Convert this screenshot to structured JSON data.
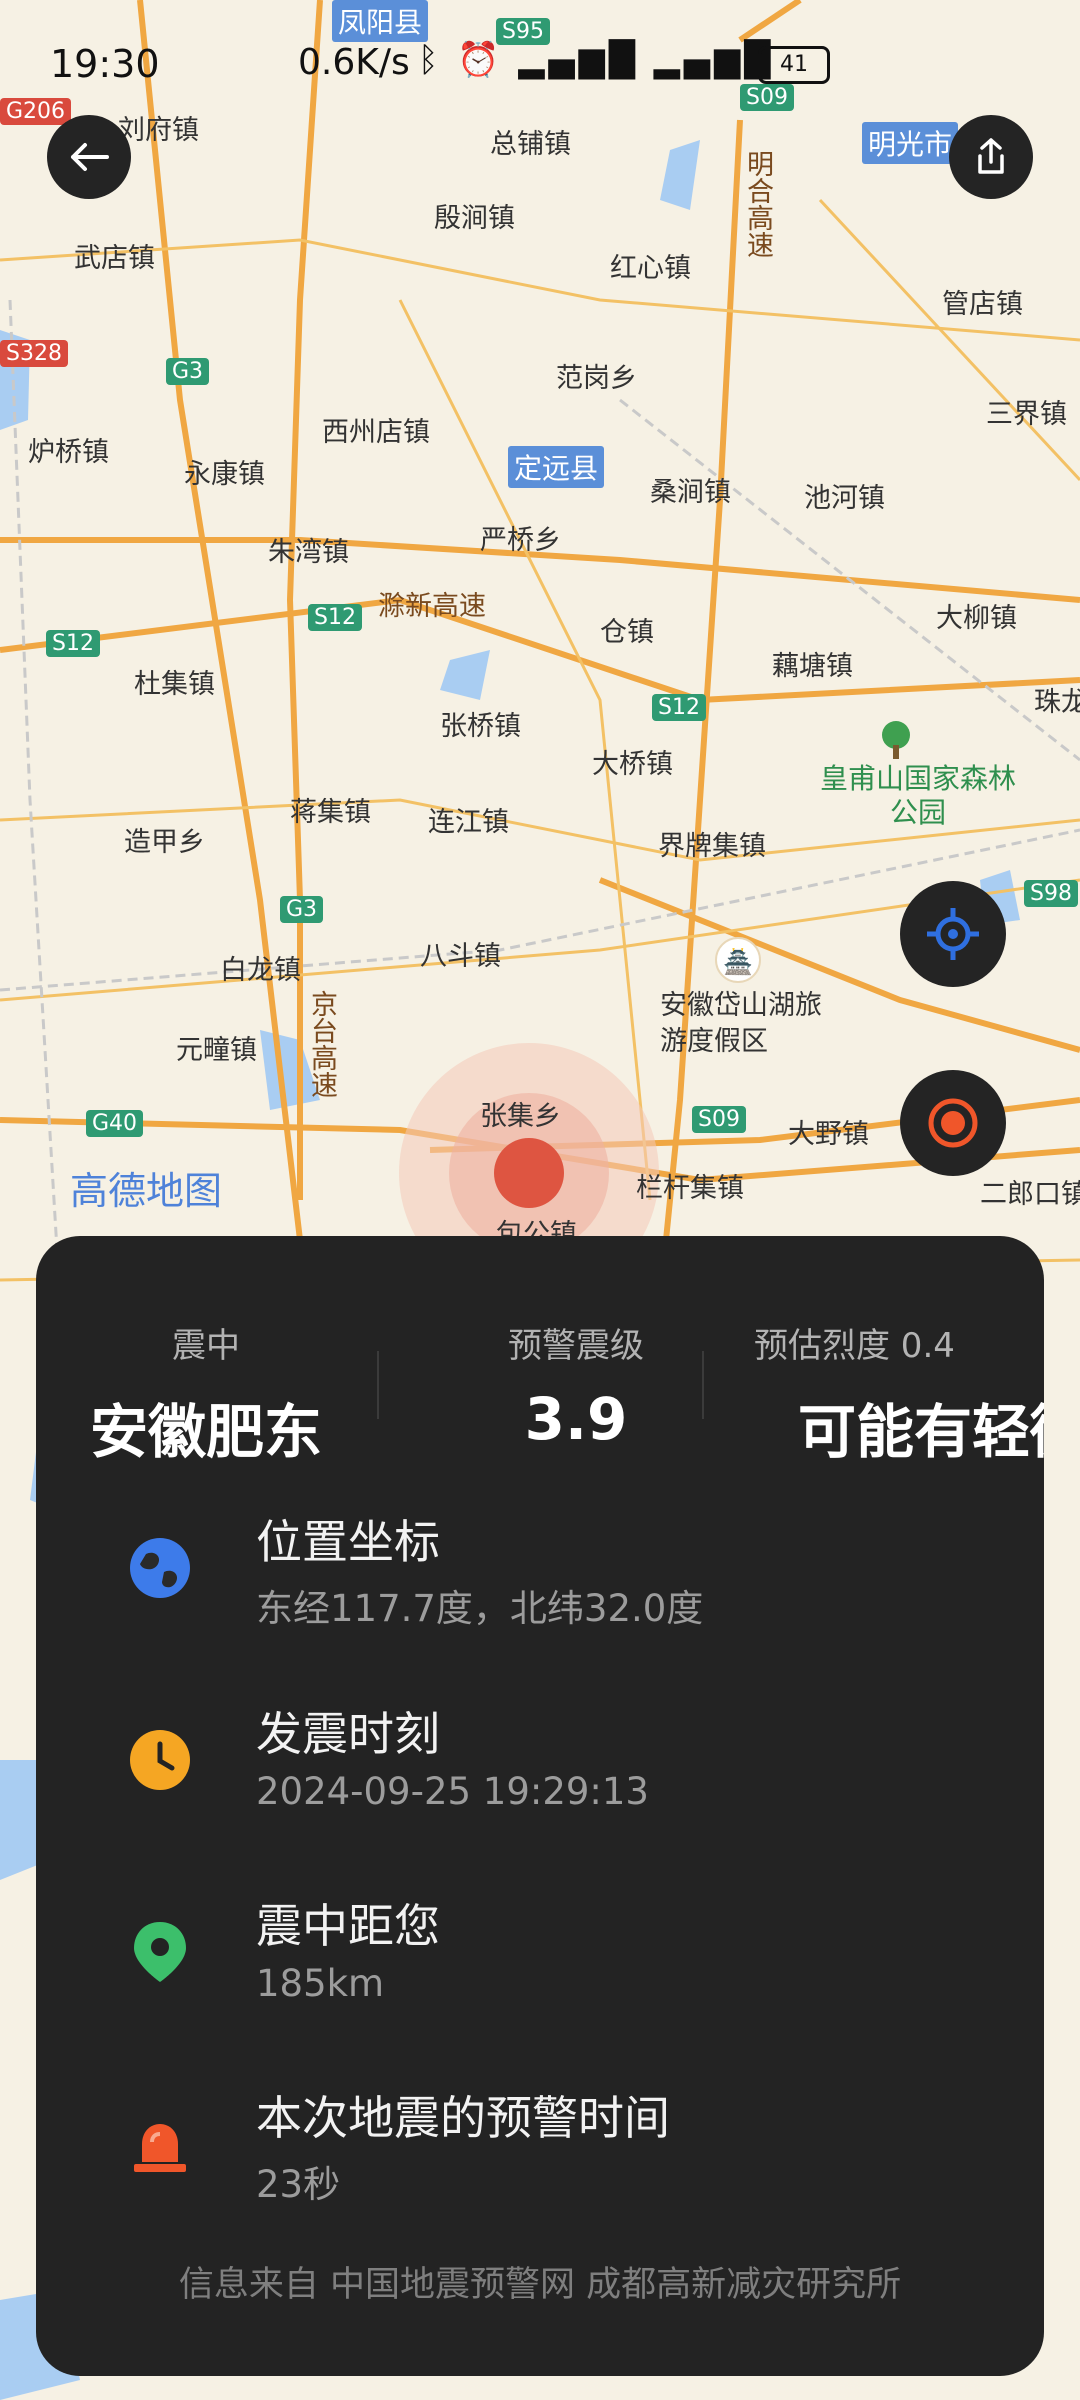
{
  "status_bar": {
    "time": "19:30",
    "network_speed": "0.6K/s",
    "battery": "41"
  },
  "map": {
    "watermark": "高德地图",
    "labels": [
      "凤阳县",
      "刘府镇",
      "总铺镇",
      "殷涧镇",
      "明光市",
      "武店镇",
      "红心镇",
      "管店镇",
      "范岗乡",
      "西州店镇",
      "永康镇",
      "桑涧镇",
      "池河镇",
      "炉桥镇",
      "三界镇",
      "朱湾镇",
      "严桥乡",
      "仓镇",
      "大柳镇",
      "杜集镇",
      "藕塘镇",
      "张桥镇",
      "大桥镇",
      "珠龙",
      "造甲乡",
      "蒋集镇",
      "连江镇",
      "界牌集镇",
      "八斗镇",
      "白龙镇",
      "元疃镇",
      "张集乡",
      "大野镇",
      "栏杆集镇",
      "二郎口镇",
      "包公镇",
      "安徽岱山湖旅游度假区",
      "皇甫山国家森林公园"
    ],
    "counties": [
      "定远县"
    ],
    "roads": [
      "S95",
      "S09",
      "G3",
      "S12",
      "S12",
      "S12",
      "G3",
      "S09",
      "G40",
      "S98",
      "G206",
      "S328",
      "滁新高速",
      "明合高速",
      "京台高速"
    ]
  },
  "buttons": {
    "back": "back",
    "share": "share",
    "locate": "locate",
    "epicenter": "epicenter"
  },
  "panel": {
    "stats": [
      {
        "label": "震中",
        "value": "安徽肥东"
      },
      {
        "label": "预警震级",
        "value": "3.9"
      },
      {
        "label": "预估烈度 0.4",
        "value": "可能有轻微震感"
      }
    ],
    "rows": [
      {
        "title": "位置坐标",
        "sub": "东经117.7度，北纬32.0度",
        "icon": "globe-icon"
      },
      {
        "title": "发震时刻",
        "sub": "2024-09-25 19:29:13",
        "icon": "clock-icon"
      },
      {
        "title": "震中距您",
        "sub": "185km",
        "icon": "map-pin-icon"
      },
      {
        "title": "本次地震的预警时间",
        "sub": "23秒",
        "icon": "alarm-light-icon"
      }
    ],
    "footer": "信息来自 中国地震预警网 成都高新减灾研究所"
  },
  "colors": {
    "panel_bg": "#232323",
    "epicenter": "#de5541",
    "locate_blue": "#2f6fe0",
    "alert_orange": "#f0562a"
  }
}
